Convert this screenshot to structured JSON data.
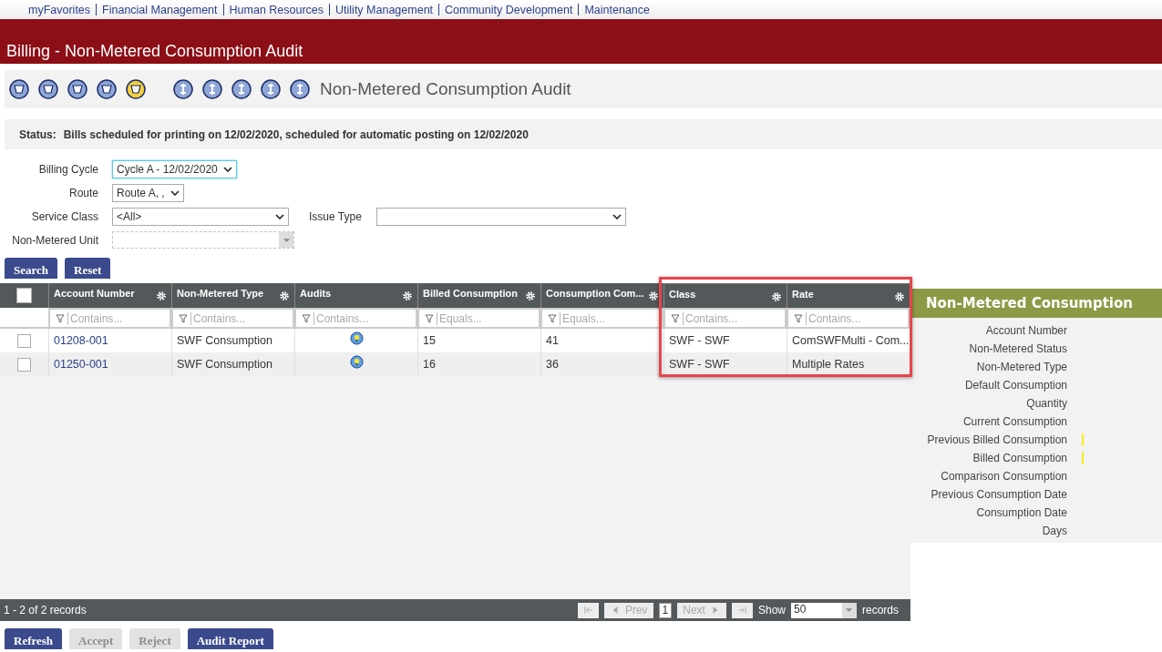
{
  "nav": [
    "myFavorites",
    "Financial Management",
    "Human Resources",
    "Utility Management",
    "Community Development",
    "Maintenance"
  ],
  "header": {
    "title": "Billing - Non-Metered Consumption Audit"
  },
  "toolbar": {
    "title": "Non-Metered Consumption Audit"
  },
  "status": {
    "label": "Status:",
    "text": "Bills scheduled for printing on 12/02/2020, scheduled for automatic posting on 12/02/2020"
  },
  "filters": [
    {
      "label": "Billing Cycle",
      "value": "Cycle A - 12/02/2020",
      "kind": "select",
      "focused": true,
      "disabled": false
    },
    {
      "label": "Route",
      "value": "Route A, ,",
      "kind": "select",
      "focused": false,
      "disabled": false
    },
    {
      "label": "Service Class",
      "value": "<All>",
      "kind": "select",
      "focused": false,
      "disabled": false,
      "side": {
        "label": "Issue Type"
      }
    },
    {
      "label": "Non-Metered Unit",
      "kind": "combo",
      "focused": false,
      "disabled": true
    }
  ],
  "search_buttons": [
    "Search",
    "Reset"
  ],
  "table": {
    "all_checked": false,
    "columns": [
      {
        "title": "Account Number",
        "filter": "Contains...",
        "highlighted": false
      },
      {
        "title": "Non-Metered Type",
        "filter": "Contains...",
        "highlighted": false
      },
      {
        "title": "Audits",
        "filter": "Contains...",
        "highlighted": false
      },
      {
        "title": "Billed Consumption",
        "filter": "Equals...",
        "highlighted": false
      },
      {
        "title": "Consumption Com...",
        "filter": "Equals...",
        "highlighted": false
      },
      {
        "title": "Class",
        "filter": "Contains...",
        "highlighted": true
      },
      {
        "title": "Rate",
        "filter": "Contains...",
        "highlighted": true
      }
    ],
    "rows": [
      {
        "checked": false,
        "cells": [
          "01208-001",
          "SWF Consumption",
          {
            "kind": "audit-icon"
          },
          "15",
          "41",
          "SWF - SWF",
          "ComSWFMulti - Com..."
        ]
      },
      {
        "checked": false,
        "cells": [
          "01250-001",
          "SWF Consumption",
          {
            "kind": "audit-icon"
          },
          "16",
          "36",
          "SWF - SWF",
          "Multiple Rates"
        ]
      }
    ]
  },
  "pager": {
    "summary": "1 - 2 of 2 records",
    "prev": "Prev",
    "page": "1",
    "next": "Next",
    "show": "Show",
    "page_size": "50",
    "records": "records"
  },
  "bottom_buttons": [
    {
      "label": "Refresh",
      "disabled": false
    },
    {
      "label": "Accept",
      "disabled": true
    },
    {
      "label": "Reject",
      "disabled": true
    },
    {
      "label": "Audit Report",
      "disabled": false
    }
  ],
  "panel": {
    "title": "Non-Metered Consumption",
    "fields": [
      {
        "label": "Account Number",
        "flagged": false
      },
      {
        "label": "Non-Metered Status",
        "flagged": false
      },
      {
        "label": "Non-Metered Type",
        "flagged": false
      },
      {
        "label": "Default Consumption",
        "flagged": false
      },
      {
        "label": "Quantity",
        "flagged": false
      },
      {
        "label": "Current Consumption",
        "flagged": false
      },
      {
        "label": "Previous Billed Consumption",
        "flagged": true
      },
      {
        "label": "Billed Consumption",
        "flagged": true
      },
      {
        "label": "Comparison Consumption",
        "flagged": false
      },
      {
        "label": "Previous Consumption Date",
        "flagged": false
      },
      {
        "label": "Consumption Date",
        "flagged": false
      },
      {
        "label": "Days",
        "flagged": false
      }
    ]
  }
}
